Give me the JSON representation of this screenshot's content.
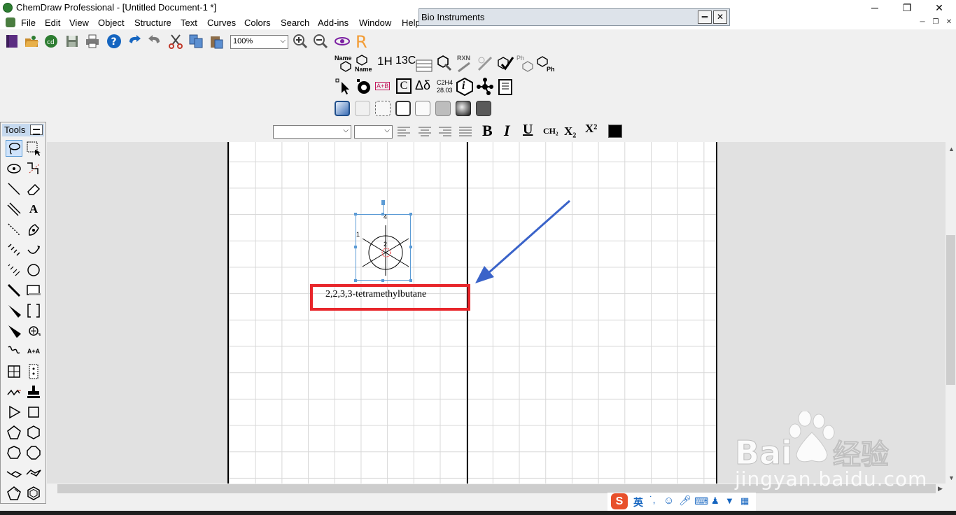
{
  "window": {
    "title": "ChemDraw Professional - [Untitled Document-1 *]",
    "minimize_glyph": "─",
    "restore_glyph": "❐",
    "close_glyph": "✕"
  },
  "menu": {
    "items": [
      "File",
      "Edit",
      "View",
      "Object",
      "Structure",
      "Text",
      "Curves",
      "Colors",
      "Search",
      "Add-ins",
      "Window",
      "Help"
    ]
  },
  "bio_window": {
    "title": "Bio Instruments"
  },
  "toolbar": {
    "zoom_value": "100%"
  },
  "bio_toolbar": {
    "name_label": "Name",
    "h_nmr_label": "1H",
    "c_nmr_label": "13C",
    "rxn_label": "RXN",
    "ph_label": "Ph",
    "delta_label": "Δδ",
    "formula_top": "C2H4",
    "formula_bottom": "28.03",
    "info_label": "i",
    "ab_label": "A+B",
    "c_bracket_label": "C"
  },
  "format_toolbar": {
    "bold": "B",
    "italic": "I",
    "underline": "U",
    "ch2": "CH₂",
    "subscript": "X₂",
    "superscript": "X²"
  },
  "tools_panel": {
    "title": "Tools",
    "text_tool": "A",
    "aa_tool": "A+A"
  },
  "document": {
    "compound_label": "2,2,3,3-tetramethylbutane",
    "atom_numbers": [
      "1",
      "2",
      "4"
    ]
  },
  "ime": {
    "lang": "英"
  },
  "watermark": {
    "brand": "Bai du 经验",
    "url": "jingyan.baidu.com"
  },
  "colors": {
    "highlight_red": "#e8262b",
    "arrow_blue": "#3a63c9",
    "selection_blue": "#5b9bd5"
  }
}
